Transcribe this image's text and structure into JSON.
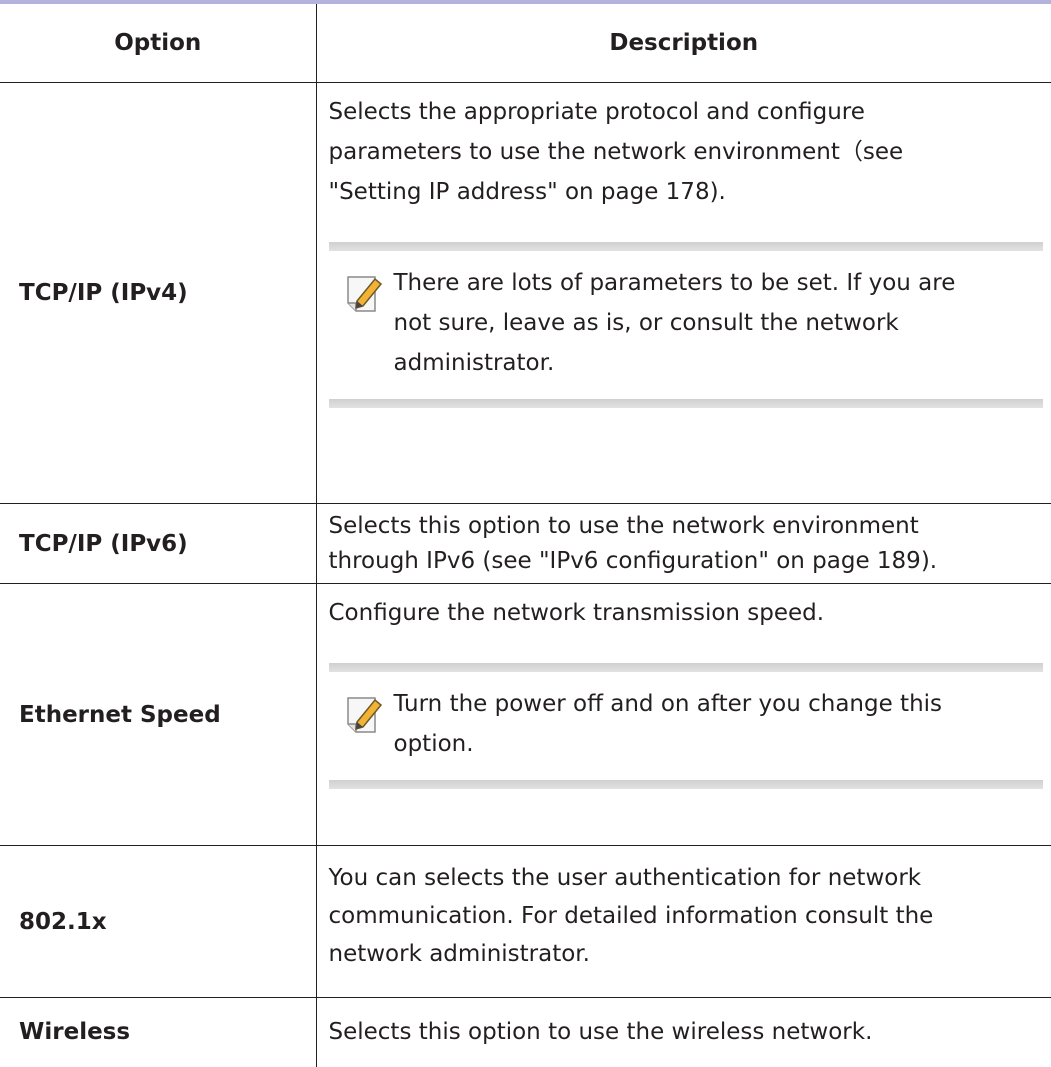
{
  "table": {
    "headers": {
      "option": "Option",
      "description": "Description"
    },
    "rows": [
      {
        "option": "TCP/IP (IPv4)",
        "description": [
          "Selects the appropriate protocol and configure",
          "parameters to use the network environment（see",
          "\"Setting IP address\" on page 178)."
        ],
        "note": [
          "There are lots of parameters to be set. If you are",
          "not sure, leave as is, or consult the network",
          "administrator."
        ]
      },
      {
        "option": "TCP/IP (IPv6)",
        "description": [
          "Selects this option to use the network environment",
          "through IPv6 (see \"IPv6 configuration\" on page 189)."
        ]
      },
      {
        "option": "Ethernet Speed",
        "description": [
          "Configure the network transmission speed."
        ],
        "note": [
          "Turn the power off and on after you change this",
          "option."
        ]
      },
      {
        "option": "802.1x",
        "description": [
          "You can selects the user authentication for network",
          "communication. For detailed information consult the",
          "network administrator."
        ]
      },
      {
        "option": "Wireless",
        "description": [
          "Selects this option to use the wireless network."
        ]
      }
    ]
  },
  "icons": {
    "note": "note-pencil-icon"
  },
  "colors": {
    "top_rule": "#b3b3de",
    "note_bar": "#d6d6d6",
    "pencil": "#f2b233"
  }
}
